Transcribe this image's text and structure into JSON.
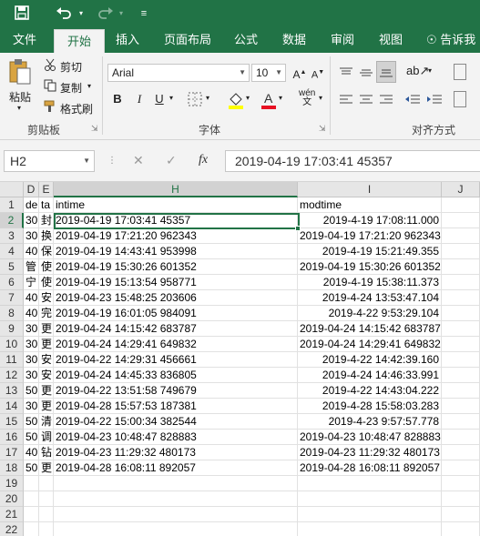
{
  "quick_access": {
    "save_icon": "save-icon",
    "undo_icon": "undo-icon",
    "redo_icon": "redo-icon",
    "customize_icon": "customize-icon"
  },
  "tabs": [
    "文件",
    "开始",
    "插入",
    "页面布局",
    "公式",
    "数据",
    "审阅",
    "视图"
  ],
  "tell_me": "告诉我您",
  "clipboard": {
    "paste": "粘贴",
    "cut": "剪切",
    "copy": "复制",
    "format_painter": "格式刷",
    "group": "剪贴板"
  },
  "font": {
    "name": "Arial",
    "size": "10",
    "bold": "B",
    "italic": "I",
    "underline": "U",
    "group": "字体"
  },
  "alignment": {
    "group": "对齐方式"
  },
  "name_box": "H2",
  "formula": "2019-04-19 17:03:41  45357",
  "columns": [
    {
      "label": "D",
      "sel": false
    },
    {
      "label": "E",
      "sel": false
    },
    {
      "label": "H",
      "sel": true
    },
    {
      "label": "I",
      "sel": false
    },
    {
      "label": "J",
      "sel": false
    }
  ],
  "rows": [
    {
      "n": "1",
      "d": "de",
      "e": "ta",
      "h": "intime",
      "i": "modtime",
      "ialign": "left"
    },
    {
      "n": "2",
      "d": "30",
      "e": "封",
      "h": "2019-04-19 17:03:41  45357",
      "i": "2019-4-19 17:08:11.000",
      "ialign": "right"
    },
    {
      "n": "3",
      "d": "30",
      "e": "换",
      "h": "2019-04-19 17:21:20  962343",
      "i": "2019-04-19 17:21:20  962343",
      "ialign": "right"
    },
    {
      "n": "4",
      "d": "40",
      "e": "保",
      "h": "2019-04-19 14:43:41  953998",
      "i": "2019-4-19 15:21:49.355",
      "ialign": "right"
    },
    {
      "n": "5",
      "d": "管",
      "e": "使",
      "h": "2019-04-19 15:30:26  601352",
      "i": "2019-04-19 15:30:26  601352",
      "ialign": "right"
    },
    {
      "n": "6",
      "d": "宁",
      "e": "使",
      "h": "2019-04-19 15:13:54  958771",
      "i": "2019-4-19 15:38:11.373",
      "ialign": "right"
    },
    {
      "n": "7",
      "d": "40",
      "e": "安",
      "h": "2019-04-23 15:48:25  203606",
      "i": "2019-4-24 13:53:47.104",
      "ialign": "right"
    },
    {
      "n": "8",
      "d": "40",
      "e": "完",
      "h": "2019-04-19 16:01:05  984091",
      "i": "2019-4-22 9:53:29.104",
      "ialign": "right"
    },
    {
      "n": "9",
      "d": "30",
      "e": "更",
      "h": "2019-04-24 14:15:42  683787",
      "i": "2019-04-24 14:15:42  683787",
      "ialign": "right"
    },
    {
      "n": "10",
      "d": "30",
      "e": "更",
      "h": "2019-04-24 14:29:41  649832",
      "i": "2019-04-24 14:29:41  649832",
      "ialign": "right"
    },
    {
      "n": "11",
      "d": "30",
      "e": "安",
      "h": "2019-04-22 14:29:31  456661",
      "i": "2019-4-22 14:42:39.160",
      "ialign": "right"
    },
    {
      "n": "12",
      "d": "30",
      "e": "安",
      "h": "2019-04-24 14:45:33  836805",
      "i": "2019-4-24 14:46:33.991",
      "ialign": "right"
    },
    {
      "n": "13",
      "d": "50",
      "e": "更",
      "h": "2019-04-22 13:51:58  749679",
      "i": "2019-4-22 14:43:04.222",
      "ialign": "right"
    },
    {
      "n": "14",
      "d": "30",
      "e": "更",
      "h": "2019-04-28 15:57:53  187381",
      "i": "2019-4-28 15:58:03.283",
      "ialign": "right"
    },
    {
      "n": "15",
      "d": "50",
      "e": "清",
      "h": "2019-04-22 15:00:34  382544",
      "i": "2019-4-23 9:57:57.778",
      "ialign": "right"
    },
    {
      "n": "16",
      "d": "50",
      "e": "调",
      "h": "2019-04-23 10:48:47  828883",
      "i": "2019-04-23 10:48:47  828883",
      "ialign": "right"
    },
    {
      "n": "17",
      "d": "40",
      "e": "钻",
      "h": "2019-04-23 11:29:32  480173",
      "i": "2019-04-23 11:29:32  480173",
      "ialign": "right"
    },
    {
      "n": "18",
      "d": "50",
      "e": "更",
      "h": "2019-04-28 16:08:11  892057",
      "i": "2019-04-28 16:08:11  892057",
      "ialign": "right"
    },
    {
      "n": "19",
      "d": "",
      "e": "",
      "h": "",
      "i": "",
      "ialign": "left"
    },
    {
      "n": "20",
      "d": "",
      "e": "",
      "h": "",
      "i": "",
      "ialign": "left"
    },
    {
      "n": "21",
      "d": "",
      "e": "",
      "h": "",
      "i": "",
      "ialign": "left"
    },
    {
      "n": "22",
      "d": "",
      "e": "",
      "h": "",
      "i": "",
      "ialign": "left"
    }
  ],
  "colors": {
    "accent": "#217346",
    "font_color_bar": "#e81123",
    "highlight_bar": "#ffff00"
  }
}
